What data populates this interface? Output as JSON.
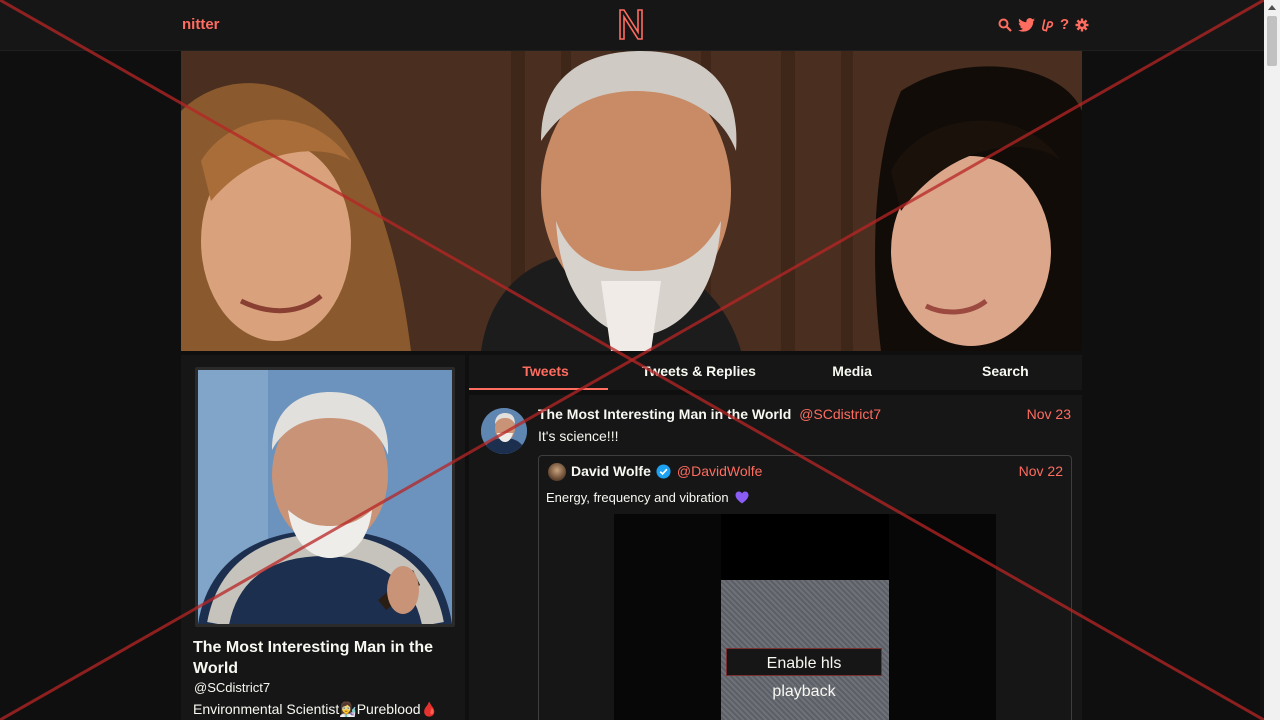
{
  "navbar": {
    "site_name": "nitter",
    "logo_letter": "N",
    "icons": [
      "search-icon",
      "twitter-bird-icon",
      "liberapay-icon",
      "help-icon",
      "gear-icon"
    ],
    "help_glyph": "?"
  },
  "profile": {
    "fullname": "The Most Interesting Man in the World",
    "username": "@SCdistrict7",
    "bio": "Environmental Scientist👩‍🔬Pureblood🩸"
  },
  "tabs": [
    {
      "label": "Tweets",
      "active": true
    },
    {
      "label": "Tweets & Replies",
      "active": false
    },
    {
      "label": "Media",
      "active": false
    },
    {
      "label": "Search",
      "active": false
    }
  ],
  "tweet": {
    "fullname": "The Most Interesting Man in the World",
    "username": "@SCdistrict7",
    "date": "Nov 23",
    "content": "It's science!!!",
    "quote": {
      "fullname": "David Wolfe",
      "verified": true,
      "username": "@DavidWolfe",
      "date": "Nov 22",
      "text": "Energy, frequency and vibration",
      "video_button": "Enable hls playback"
    }
  },
  "colors": {
    "accent": "#ff6c60",
    "background": "#0f0f0f",
    "panel": "#161616",
    "text": "#f8f8f2",
    "verified": "#1da1f2",
    "heart": "#8b5cf6"
  }
}
